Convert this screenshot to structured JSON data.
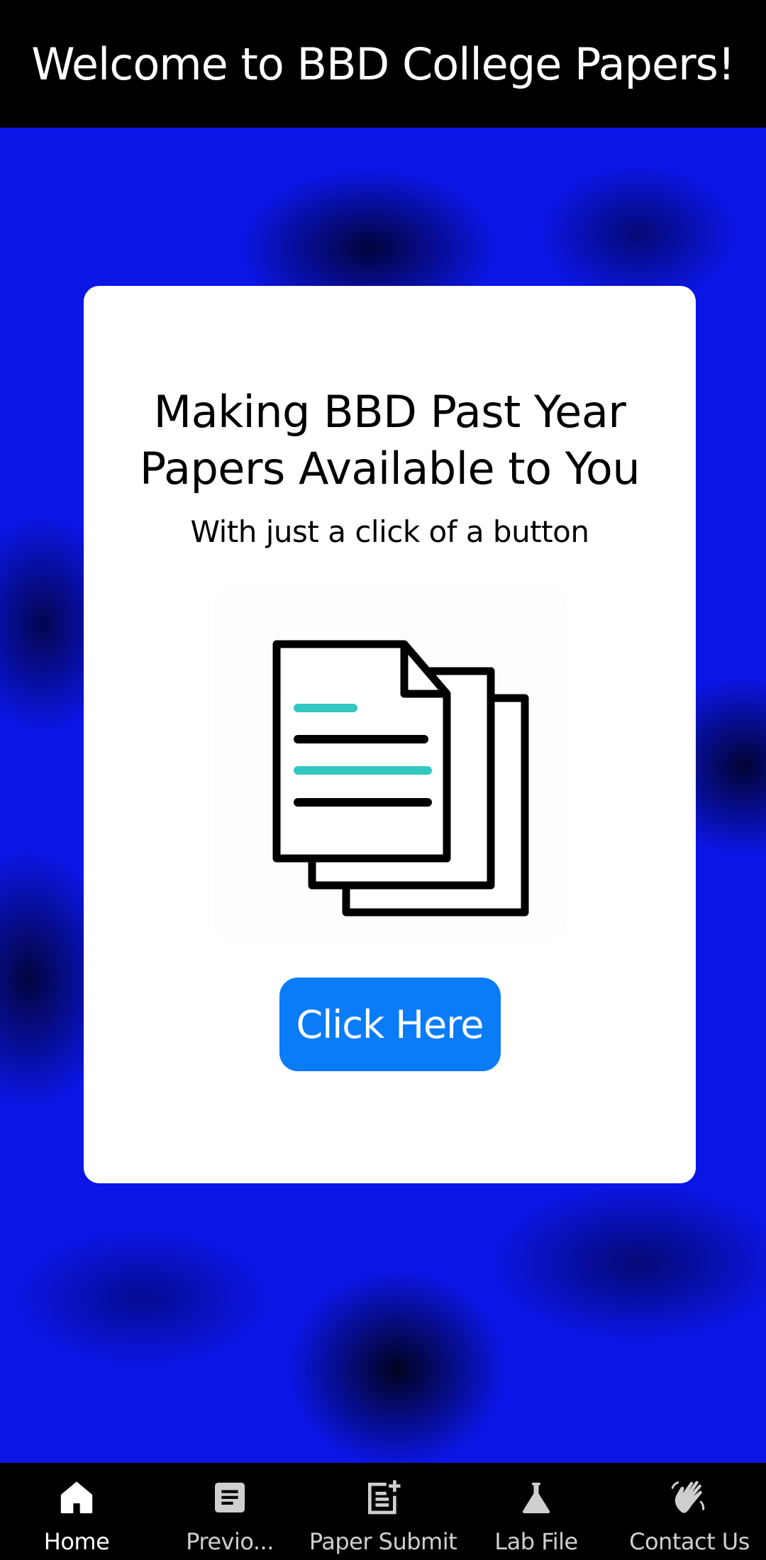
{
  "header": {
    "title": "Welcome to BBD College Papers!"
  },
  "card": {
    "title_line1": "Making BBD Past Year",
    "title_line2": "Papers Available to You",
    "subtitle": "With just a click of a button",
    "illustration_icon": "documents-icon",
    "button_label": "Click Here"
  },
  "nav": {
    "items": [
      {
        "label": "Home",
        "icon": "home-icon",
        "active": true
      },
      {
        "label": "Previo...",
        "icon": "article-icon",
        "active": false
      },
      {
        "label": "Paper Submit",
        "icon": "post-add-icon",
        "active": false
      },
      {
        "label": "Lab File",
        "icon": "flask-icon",
        "active": false
      },
      {
        "label": "Contact Us",
        "icon": "waving-hand-icon",
        "active": false
      }
    ]
  },
  "colors": {
    "header_bg": "#000000",
    "background": "#0b16e6",
    "button": "#0a7cf8",
    "accent_teal": "#33c7c2"
  }
}
